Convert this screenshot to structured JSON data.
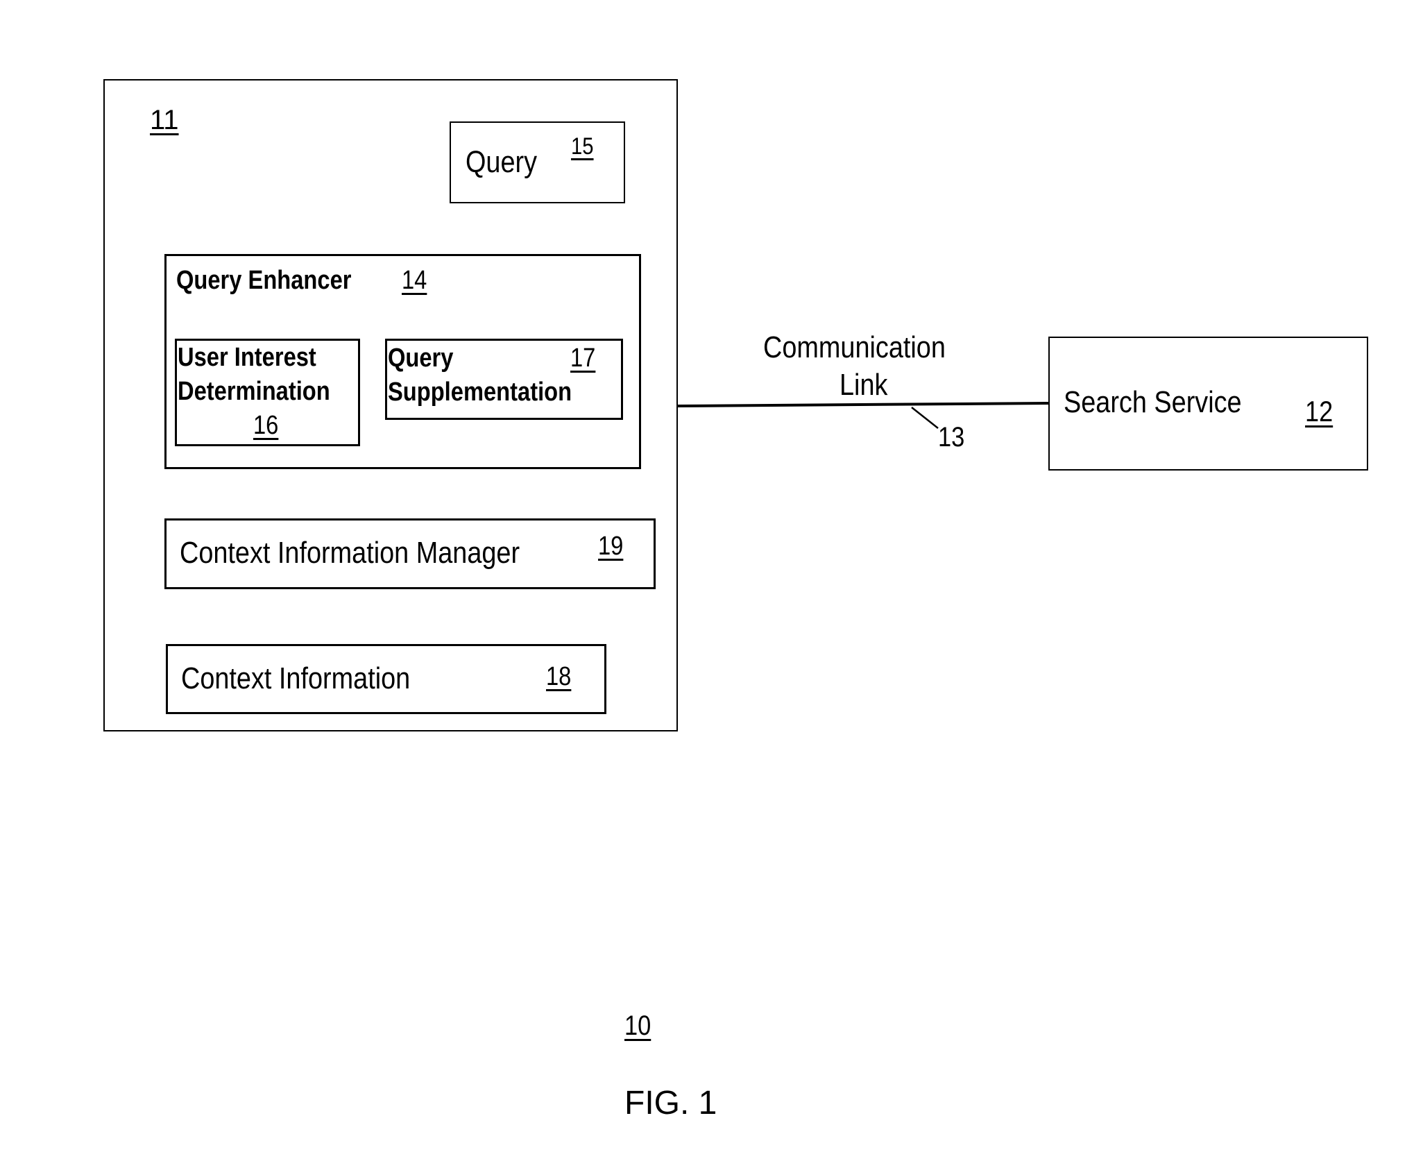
{
  "figure": {
    "label": "FIG. 1",
    "system_ref": "10"
  },
  "client_device": {
    "ref": "11",
    "query": {
      "label": "Query",
      "ref": "15"
    },
    "query_enhancer": {
      "label": "Query Enhancer",
      "ref": "14",
      "user_interest": {
        "line1": "User Interest",
        "line2": "Determination",
        "ref": "16"
      },
      "query_supplementation": {
        "line1": "Query",
        "line2": "Supplementation",
        "ref": "17"
      }
    },
    "context_information_manager": {
      "label": "Context Information Manager",
      "ref": "19"
    },
    "context_information": {
      "label": "Context Information",
      "ref": "18"
    }
  },
  "communication_link": {
    "line1": "Communication",
    "line2": "Link",
    "ref": "13"
  },
  "search_service": {
    "label": "Search Service",
    "ref": "12"
  },
  "colors": {
    "ink": "#000000",
    "paper": "#ffffff"
  }
}
